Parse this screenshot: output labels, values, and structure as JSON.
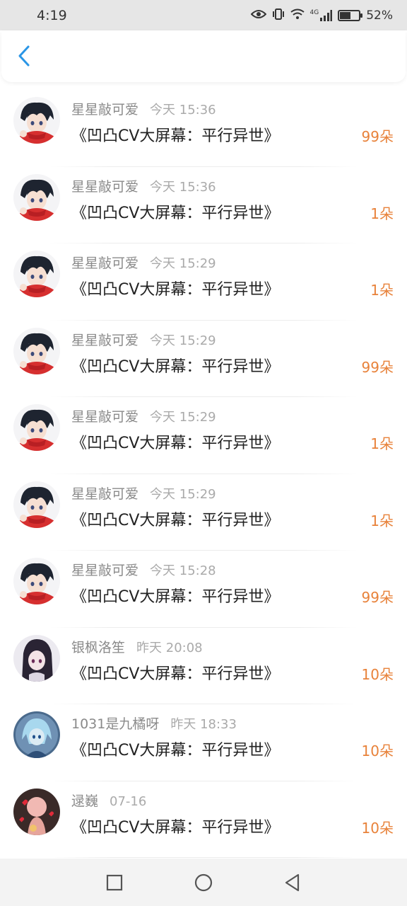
{
  "status_bar": {
    "time": "4:19",
    "battery_percent": "52%",
    "network": "4G",
    "icons": [
      "eye-icon",
      "vibrate-icon",
      "wifi-icon",
      "signal-icon",
      "battery-icon"
    ]
  },
  "header": {
    "back_icon": "chevron-left-icon"
  },
  "colors": {
    "accent": "#2a96e6",
    "count": "#e8823a",
    "sender": "#8a8a8a",
    "time": "#aaaaaa"
  },
  "items": [
    {
      "sender": "星星敲可爱",
      "time": "今天 15:36",
      "title": "《凹凸CV大屏幕：平行异世》",
      "count": "99朵",
      "avatar": "avatar-red-scarf"
    },
    {
      "sender": "星星敲可爱",
      "time": "今天 15:36",
      "title": "《凹凸CV大屏幕：平行异世》",
      "count": "1朵",
      "avatar": "avatar-red-scarf"
    },
    {
      "sender": "星星敲可爱",
      "time": "今天 15:29",
      "title": "《凹凸CV大屏幕：平行异世》",
      "count": "1朵",
      "avatar": "avatar-red-scarf"
    },
    {
      "sender": "星星敲可爱",
      "time": "今天 15:29",
      "title": "《凹凸CV大屏幕：平行异世》",
      "count": "99朵",
      "avatar": "avatar-red-scarf"
    },
    {
      "sender": "星星敲可爱",
      "time": "今天 15:29",
      "title": "《凹凸CV大屏幕：平行异世》",
      "count": "1朵",
      "avatar": "avatar-red-scarf"
    },
    {
      "sender": "星星敲可爱",
      "time": "今天 15:29",
      "title": "《凹凸CV大屏幕：平行异世》",
      "count": "1朵",
      "avatar": "avatar-red-scarf"
    },
    {
      "sender": "星星敲可爱",
      "time": "今天 15:28",
      "title": "《凹凸CV大屏幕：平行异世》",
      "count": "99朵",
      "avatar": "avatar-red-scarf"
    },
    {
      "sender": "银枫洛笙",
      "time": "昨天 20:08",
      "title": "《凹凸CV大屏幕：平行异世》",
      "count": "10朵",
      "avatar": "avatar-dark-hair"
    },
    {
      "sender": "1031是九橘呀",
      "time": "昨天 18:33",
      "title": "《凹凸CV大屏幕：平行异世》",
      "count": "10朵",
      "avatar": "avatar-blue"
    },
    {
      "sender": "逯巍",
      "time": "07-16",
      "title": "《凹凸CV大屏幕：平行异世》",
      "count": "10朵",
      "avatar": "avatar-hearts"
    }
  ],
  "nav": {
    "icons": [
      "recent-apps-icon",
      "home-icon",
      "back-icon"
    ]
  }
}
